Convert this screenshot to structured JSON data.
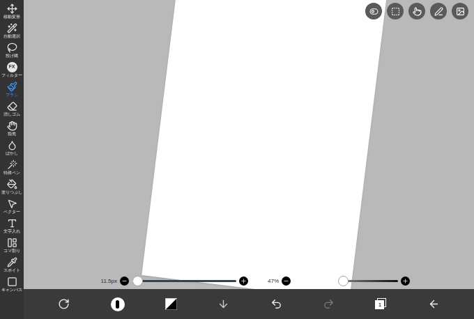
{
  "tools": [
    {
      "label": "移動変形",
      "selected": false
    },
    {
      "label": "自動選択",
      "selected": false
    },
    {
      "label": "投げ縄",
      "selected": false
    },
    {
      "label": "フィルター",
      "selected": false,
      "badge": "FX"
    },
    {
      "label": "ブラシ",
      "selected": true
    },
    {
      "label": "消しゴム",
      "selected": false
    },
    {
      "label": "指先",
      "selected": false
    },
    {
      "label": "ぼかし",
      "selected": false
    },
    {
      "label": "特殊ペン",
      "selected": false
    },
    {
      "label": "塗りつぶし",
      "selected": false
    },
    {
      "label": "ベクター",
      "selected": false
    },
    {
      "label": "文字入れ",
      "selected": false
    },
    {
      "label": "コマ割り",
      "selected": false
    },
    {
      "label": "スポイト",
      "selected": false
    },
    {
      "label": "キャンバス",
      "selected": false
    }
  ],
  "brush_size": {
    "reading": "11.5px",
    "level": 0.05
  },
  "opacity": {
    "reading": "47%",
    "level": 0.47
  },
  "bottom_bar": {
    "redo_disabled": true,
    "layer_count": "1"
  }
}
